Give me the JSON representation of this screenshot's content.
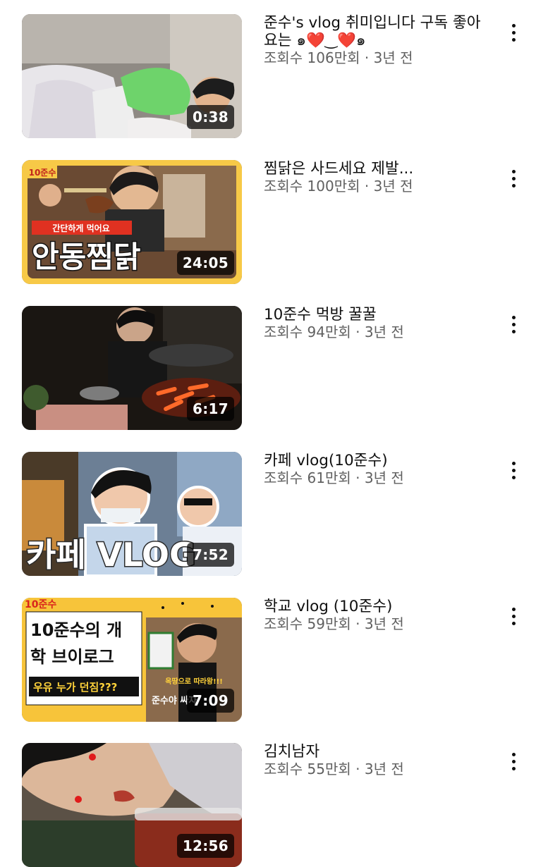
{
  "videos": [
    {
      "title": "준수's vlog    취미입니다 구독 좋아요는 ๑❤️‿❤️๑",
      "views": "조회수 106만회",
      "age": "3년 전",
      "duration": "0:38",
      "thumbnail_text": []
    },
    {
      "title": "찜닭은 사드세요 제발...",
      "views": "조회수 100만회",
      "age": "3년 전",
      "duration": "24:05",
      "thumbnail_text": [
        "10준수",
        "간단하게 먹어요",
        "안동찜닭"
      ]
    },
    {
      "title": "10준수 먹방 꿀꿀",
      "views": "조회수 94만회",
      "age": "3년 전",
      "duration": "6:17",
      "thumbnail_text": []
    },
    {
      "title": "카페 vlog(10준수)",
      "views": "조회수 61만회",
      "age": "3년 전",
      "duration": "7:52",
      "thumbnail_text": [
        "카페 VLOG"
      ]
    },
    {
      "title": "학교 vlog (10준수)",
      "views": "조회수 59만회",
      "age": "3년 전",
      "duration": "7:09",
      "thumbnail_text": [
        "10준수",
        "10준수의 개",
        "학 브이로그",
        "우유 누가 던짐???",
        "옥땅으로 따라왕!!!",
        "준수야 싸자"
      ]
    },
    {
      "title": "김치남자",
      "views": "조회수 55만회",
      "age": "3년 전",
      "duration": "12:56",
      "thumbnail_text": []
    }
  ],
  "separator": " · ",
  "menu_icon": "more-vert-icon"
}
